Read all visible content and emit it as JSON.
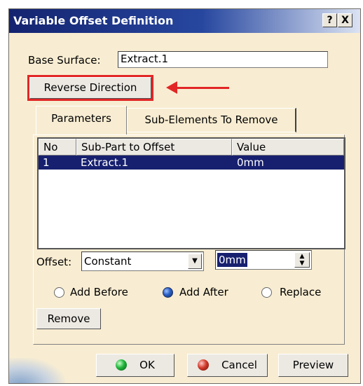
{
  "window": {
    "title": "Variable Offset Definition",
    "help": "?",
    "close": "X"
  },
  "base_surface": {
    "label": "Base Surface:",
    "value": "Extract.1"
  },
  "reverse_direction": "Reverse Direction",
  "tabs": [
    {
      "label": "Parameters"
    },
    {
      "label": "Sub-Elements To Remove"
    }
  ],
  "table": {
    "headers": [
      "No",
      "Sub-Part to Offset",
      "Value"
    ],
    "rows": [
      {
        "no": "1",
        "sub_part": "Extract.1",
        "value": "0mm"
      }
    ]
  },
  "offset": {
    "label": "Offset:",
    "mode": "Constant",
    "value": "0mm"
  },
  "radios": [
    {
      "label": "Add Before",
      "selected": false
    },
    {
      "label": "Add After",
      "selected": true
    },
    {
      "label": "Replace",
      "selected": false
    }
  ],
  "remove": "Remove",
  "buttons": {
    "ok": "OK",
    "cancel": "Cancel",
    "preview": "Preview"
  },
  "colors": {
    "title_bar": "#14236f",
    "selection": "#17206f",
    "highlight_annotation": "#e22626",
    "dialog_bg": "#f8edd2"
  }
}
